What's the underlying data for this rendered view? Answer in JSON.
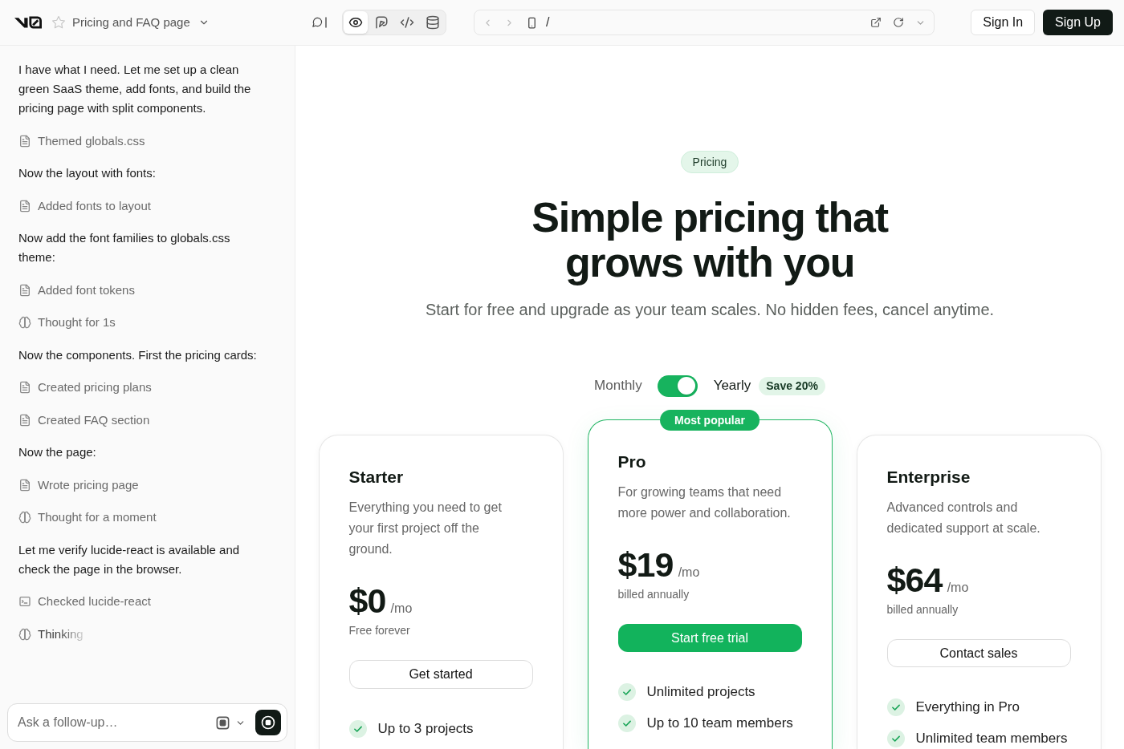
{
  "topbar": {
    "project": {
      "title": "Pricing and FAQ page",
      "favorited": false
    },
    "view_tabs": [
      {
        "kind": "preview",
        "selected": true
      },
      {
        "kind": "design",
        "selected": false
      },
      {
        "kind": "code",
        "selected": false
      },
      {
        "kind": "database",
        "selected": false
      }
    ],
    "address_bar": {
      "can_go_back": false,
      "can_go_forward": false,
      "path": "/"
    },
    "auth_buttons": [
      {
        "label": "Sign In",
        "kind": "outline"
      },
      {
        "label": "Sign Up",
        "kind": "solid"
      }
    ]
  },
  "chat": {
    "items": [
      {
        "kind": "message",
        "text": "I have what I need. Let me set up a clean green SaaS theme, add fonts, and build the pricing page with split components.",
        "in_progress": false
      },
      {
        "kind": "file",
        "text": "Themed globals.css",
        "in_progress": false
      },
      {
        "kind": "message",
        "text": "Now the layout with fonts:",
        "in_progress": false
      },
      {
        "kind": "file",
        "text": "Added fonts to layout",
        "in_progress": false
      },
      {
        "kind": "message",
        "text": "Now add the font families to globals.css theme:",
        "in_progress": false
      },
      {
        "kind": "file",
        "text": "Added font tokens",
        "in_progress": false
      },
      {
        "kind": "thought",
        "text": "Thought for 1s",
        "in_progress": false
      },
      {
        "kind": "message",
        "text": "Now the components. First the pricing cards:",
        "in_progress": false
      },
      {
        "kind": "file",
        "text": "Created pricing plans",
        "in_progress": false
      },
      {
        "kind": "file",
        "text": "Created FAQ section",
        "in_progress": false
      },
      {
        "kind": "message",
        "text": "Now the page:",
        "in_progress": false
      },
      {
        "kind": "file",
        "text": "Wrote pricing page",
        "in_progress": false
      },
      {
        "kind": "thought",
        "text": "Thought for a moment",
        "in_progress": false
      },
      {
        "kind": "message",
        "text": "Let me verify lucide-react is available and check the page in the browser.",
        "in_progress": false
      },
      {
        "kind": "command",
        "text": "Checked lucide-react",
        "in_progress": false
      },
      {
        "kind": "thought",
        "text": "Thinking",
        "in_progress": true
      }
    ],
    "composer": {
      "placeholder": "Ask a follow-up…",
      "generating": true
    }
  },
  "preview": {
    "badge": "Pricing",
    "heading": "Simple pricing that grows with you",
    "subtitle": "Start for free and upgrade as your team scales. No hidden fees, cancel anytime.",
    "billing": {
      "monthly_label": "Monthly",
      "yearly_label": "Yearly",
      "on": true,
      "discount": "Save 20%"
    },
    "plans": [
      {
        "name": "Starter",
        "featured": false,
        "description": "Everything you need to get your first project off the ground.",
        "price": "$0",
        "period": "/mo",
        "note": "Free forever",
        "button": "Get started",
        "features": [
          "Up to 3 projects"
        ]
      },
      {
        "name": "Pro",
        "featured": true,
        "badge": "Most popular",
        "description": "For growing teams that need more power and collaboration.",
        "price": "$19",
        "period": "/mo",
        "note": "billed annually",
        "button": "Start free trial",
        "features": [
          "Unlimited projects",
          "Up to 10 team members"
        ]
      },
      {
        "name": "Enterprise",
        "featured": false,
        "description": "Advanced controls and dedicated support at scale.",
        "price": "$64",
        "period": "/mo",
        "note": "billed annually",
        "button": "Contact sales",
        "features": [
          "Everything in Pro",
          "Unlimited team members"
        ]
      }
    ]
  }
}
